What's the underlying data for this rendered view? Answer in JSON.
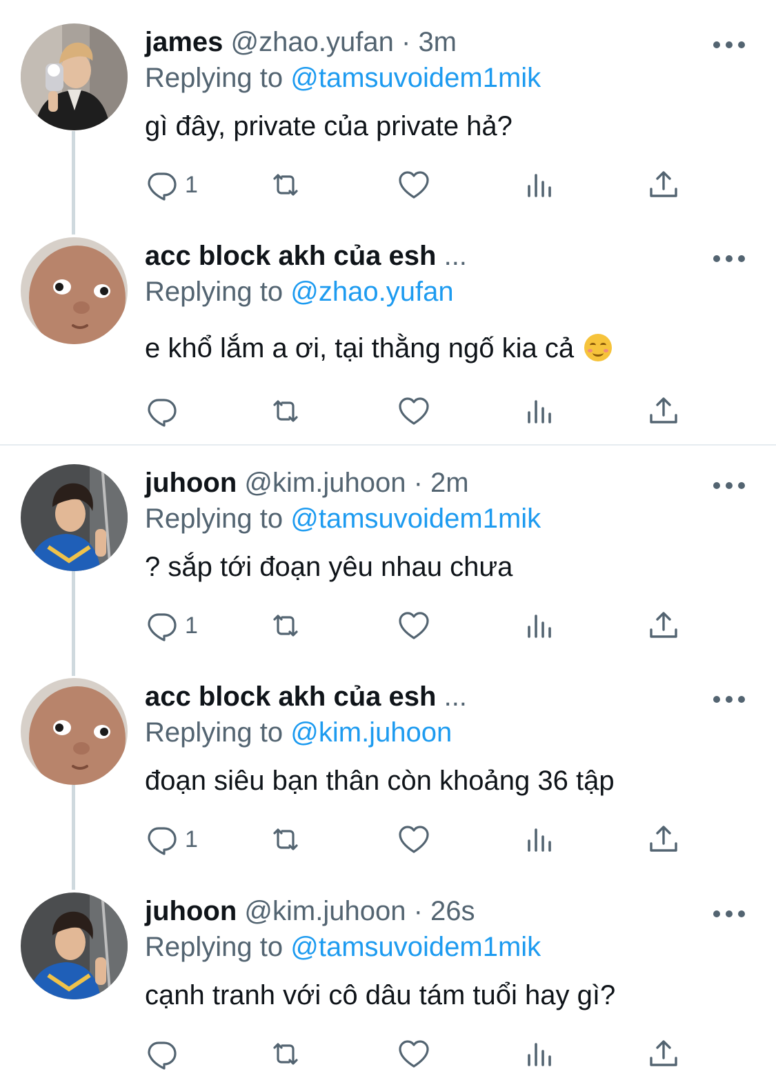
{
  "colors": {
    "accent": "#1d9bf0",
    "secondary_text": "#536471",
    "thread_line": "#cfd9de"
  },
  "tweets": [
    {
      "name": "james",
      "handle": "@zhao.yufan",
      "separator": "·",
      "time": "3m",
      "replying_prefix": "Replying to",
      "replying_to": "@tamsuvoidem1mik",
      "text": "gì đây, private của private hả?",
      "reply_count": "1",
      "avatar": "photo-avatar-man-mirror-selfie"
    },
    {
      "name": "acc block akh của esh",
      "name_ellipsis": "...",
      "replying_prefix": "Replying to",
      "replying_to": "@zhao.yufan",
      "text": "e khổ lắm a ơi, tại thằng ngố kia cả",
      "emoji": "smiling-face-emoji",
      "reply_count": "",
      "avatar": "photo-avatar-baby-doll"
    },
    {
      "name": "juhoon",
      "handle": "@kim.juhoon",
      "separator": "·",
      "time": "2m",
      "replying_prefix": "Replying to",
      "replying_to": "@tamsuvoidem1mik",
      "text": "? sắp tới đoạn yêu nhau chưa",
      "reply_count": "1",
      "avatar": "photo-avatar-boy-selfie"
    },
    {
      "name": "acc block akh của esh",
      "name_ellipsis": "...",
      "replying_prefix": "Replying to",
      "replying_to": "@kim.juhoon",
      "text": "đoạn siêu bạn thân còn khoảng 36 tập",
      "reply_count": "1",
      "avatar": "photo-avatar-baby-doll"
    },
    {
      "name": "juhoon",
      "handle": "@kim.juhoon",
      "separator": "·",
      "time": "26s",
      "replying_prefix": "Replying to",
      "replying_to": "@tamsuvoidem1mik",
      "text": "cạnh tranh với cô dâu tám tuổi hay gì?",
      "reply_count": "",
      "avatar": "photo-avatar-boy-selfie"
    }
  ],
  "icons": {
    "reply": "reply-icon",
    "retweet": "retweet-icon",
    "like": "heart-icon",
    "views": "analytics-icon",
    "share": "share-icon",
    "more": "more-icon"
  }
}
